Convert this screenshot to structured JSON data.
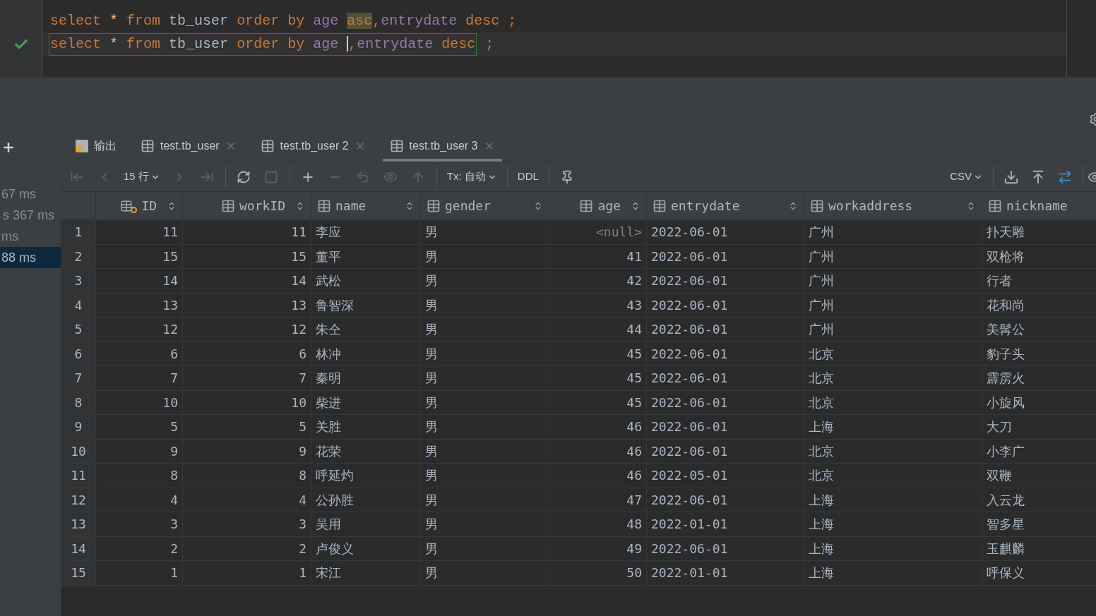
{
  "editor": {
    "lines": [
      {
        "ok": false,
        "current": false,
        "words": [
          [
            {
              "kind": "keyword",
              "text": "select"
            }
          ],
          [
            {
              "kind": "op",
              "text": "*"
            }
          ],
          [
            {
              "kind": "keyword",
              "text": "from"
            }
          ],
          [
            {
              "kind": "ident",
              "text": "tb_user"
            }
          ],
          [
            {
              "kind": "keyword",
              "text": "order"
            }
          ],
          [
            {
              "kind": "keyword",
              "text": "by"
            }
          ],
          [
            {
              "kind": "column",
              "text": "age"
            }
          ],
          [
            {
              "kind": "keyword",
              "text": "asc",
              "highlighted": true
            },
            {
              "kind": "plain",
              "text": ","
            },
            {
              "kind": "column",
              "text": "entrydate"
            }
          ],
          [
            {
              "kind": "keyword",
              "text": "desc"
            }
          ],
          [
            {
              "kind": "keyword",
              "text": ";"
            }
          ]
        ]
      },
      {
        "ok": true,
        "current": true,
        "words": [
          [
            {
              "kind": "keyword",
              "text": "select"
            }
          ],
          [
            {
              "kind": "op",
              "text": "*"
            }
          ],
          [
            {
              "kind": "keyword",
              "text": "from"
            }
          ],
          [
            {
              "kind": "ident",
              "text": "tb_user"
            }
          ],
          [
            {
              "kind": "keyword",
              "text": "order"
            }
          ],
          [
            {
              "kind": "keyword",
              "text": "by"
            }
          ],
          [
            {
              "kind": "column",
              "text": "age"
            }
          ],
          [
            {
              "kind": "caret"
            },
            {
              "kind": "plain",
              "text": ","
            },
            {
              "kind": "column",
              "text": "entrydate"
            }
          ],
          [
            {
              "kind": "keyword",
              "text": "desc"
            }
          ]
        ],
        "after": [
          [
            {
              "kind": "keyword",
              "text": ";"
            }
          ]
        ]
      }
    ]
  },
  "history": [
    {
      "text": "67 ms",
      "selected": false
    },
    {
      "text": "s 367 ms",
      "selected": false
    },
    {
      "text": "ms",
      "selected": false
    },
    {
      "text": "88 ms",
      "selected": true
    }
  ],
  "tabs": [
    {
      "kind": "output",
      "label": "输出",
      "selected": false
    },
    {
      "kind": "table",
      "label": "test.tb_user",
      "selected": false
    },
    {
      "kind": "table",
      "label": "test.tb_user 2",
      "selected": false
    },
    {
      "kind": "table",
      "label": "test.tb_user 3",
      "selected": true
    }
  ],
  "toolbar": {
    "row_count": "15 行",
    "transaction": "Tx: 自动",
    "ddl": "DDL",
    "export_format": "CSV",
    "buttons": [
      {
        "kind": "first",
        "disabled": true
      },
      {
        "kind": "prev",
        "disabled": true
      },
      {
        "kind": "count"
      },
      {
        "kind": "next",
        "disabled": true
      },
      {
        "kind": "last",
        "disabled": true
      },
      {
        "kind": "sep"
      },
      {
        "kind": "reload",
        "disabled": false
      },
      {
        "kind": "stop",
        "disabled": true
      },
      {
        "kind": "sep"
      },
      {
        "kind": "add",
        "disabled": false
      },
      {
        "kind": "remove",
        "disabled": true
      },
      {
        "kind": "revert",
        "disabled": true
      },
      {
        "kind": "preview",
        "disabled": true
      },
      {
        "kind": "submit",
        "disabled": true
      },
      {
        "kind": "sep"
      },
      {
        "kind": "tx"
      },
      {
        "kind": "sep"
      },
      {
        "kind": "ddl"
      },
      {
        "kind": "sep"
      },
      {
        "kind": "pin",
        "disabled": false
      }
    ]
  },
  "table": {
    "columns": [
      {
        "name": "ID",
        "kind": "key"
      },
      {
        "name": "workID",
        "kind": "column"
      },
      {
        "name": "name",
        "kind": "column"
      },
      {
        "name": "gender",
        "kind": "column"
      },
      {
        "name": "age",
        "kind": "column"
      },
      {
        "name": "entrydate",
        "kind": "column"
      },
      {
        "name": "workaddress",
        "kind": "column"
      },
      {
        "name": "nickname",
        "kind": "column"
      }
    ],
    "rows": [
      {
        "n": "1",
        "cells": [
          "11",
          "11",
          "李应",
          "男",
          {
            "text": "<null>",
            "null": true
          },
          "2022-06-01",
          "广州",
          "扑天雕"
        ]
      },
      {
        "n": "2",
        "cells": [
          "15",
          "15",
          "董平",
          "男",
          "41",
          "2022-06-01",
          "广州",
          "双枪将"
        ]
      },
      {
        "n": "3",
        "cells": [
          "14",
          "14",
          "武松",
          "男",
          "42",
          "2022-06-01",
          "广州",
          "行者"
        ]
      },
      {
        "n": "4",
        "cells": [
          "13",
          "13",
          "鲁智深",
          "男",
          "43",
          "2022-06-01",
          "广州",
          "花和尚"
        ]
      },
      {
        "n": "5",
        "cells": [
          "12",
          "12",
          "朱仝",
          "男",
          "44",
          "2022-06-01",
          "广州",
          "美髯公"
        ]
      },
      {
        "n": "6",
        "cells": [
          "6",
          "6",
          "林冲",
          "男",
          "45",
          "2022-06-01",
          "北京",
          "豹子头"
        ]
      },
      {
        "n": "7",
        "cells": [
          "7",
          "7",
          "秦明",
          "男",
          "45",
          "2022-06-01",
          "北京",
          "霹雳火"
        ]
      },
      {
        "n": "8",
        "cells": [
          "10",
          "10",
          "柴进",
          "男",
          "45",
          "2022-06-01",
          "北京",
          "小旋风"
        ]
      },
      {
        "n": "9",
        "cells": [
          "5",
          "5",
          "关胜",
          "男",
          "46",
          "2022-06-01",
          "上海",
          "大刀"
        ]
      },
      {
        "n": "10",
        "cells": [
          "9",
          "9",
          "花荣",
          "男",
          "46",
          "2022-06-01",
          "北京",
          "小李广"
        ]
      },
      {
        "n": "11",
        "cells": [
          "8",
          "8",
          "呼延灼",
          "男",
          "46",
          "2022-05-01",
          "北京",
          "双鞭"
        ]
      },
      {
        "n": "12",
        "cells": [
          "4",
          "4",
          "公孙胜",
          "男",
          "47",
          "2022-06-01",
          "上海",
          "入云龙"
        ]
      },
      {
        "n": "13",
        "cells": [
          "3",
          "3",
          "吴用",
          "男",
          "48",
          "2022-01-01",
          "上海",
          "智多星"
        ]
      },
      {
        "n": "14",
        "cells": [
          "2",
          "2",
          "卢俊义",
          "男",
          "49",
          "2022-06-01",
          "上海",
          "玉麒麟"
        ]
      },
      {
        "n": "15",
        "cells": [
          "1",
          "1",
          "宋江",
          "男",
          "50",
          "2022-01-01",
          "上海",
          "呼保义"
        ]
      }
    ]
  }
}
